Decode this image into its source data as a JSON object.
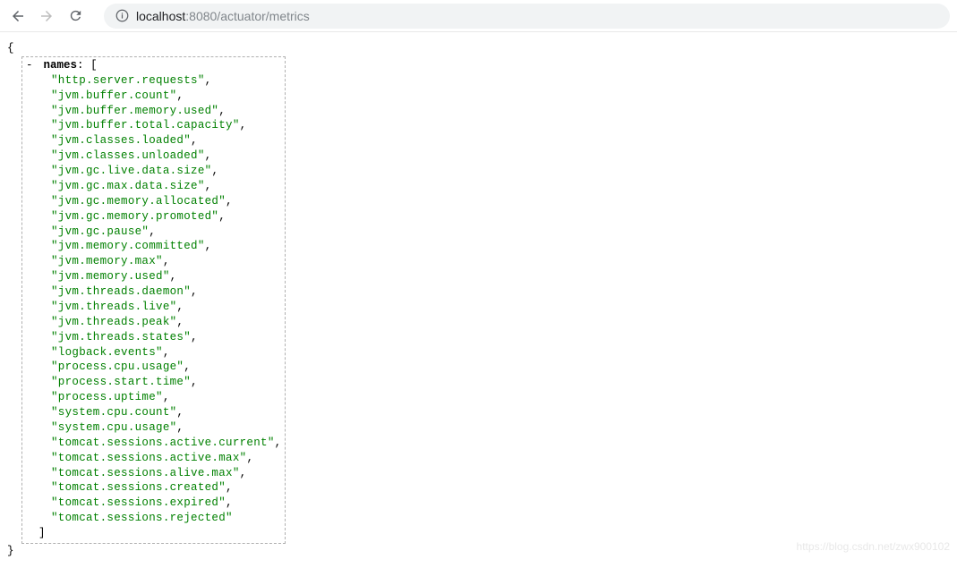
{
  "browser": {
    "url_host": "localhost",
    "url_port_path": ":8080/actuator/metrics"
  },
  "json": {
    "open_brace": "{",
    "close_brace": "}",
    "toggle": "-",
    "key": "names",
    "colon": ":",
    "open_bracket": "[",
    "close_bracket": "]",
    "values": [
      "http.server.requests",
      "jvm.buffer.count",
      "jvm.buffer.memory.used",
      "jvm.buffer.total.capacity",
      "jvm.classes.loaded",
      "jvm.classes.unloaded",
      "jvm.gc.live.data.size",
      "jvm.gc.max.data.size",
      "jvm.gc.memory.allocated",
      "jvm.gc.memory.promoted",
      "jvm.gc.pause",
      "jvm.memory.committed",
      "jvm.memory.max",
      "jvm.memory.used",
      "jvm.threads.daemon",
      "jvm.threads.live",
      "jvm.threads.peak",
      "jvm.threads.states",
      "logback.events",
      "process.cpu.usage",
      "process.start.time",
      "process.uptime",
      "system.cpu.count",
      "system.cpu.usage",
      "tomcat.sessions.active.current",
      "tomcat.sessions.active.max",
      "tomcat.sessions.alive.max",
      "tomcat.sessions.created",
      "tomcat.sessions.expired",
      "tomcat.sessions.rejected"
    ]
  },
  "watermark": "https://blog.csdn.net/zwx900102"
}
